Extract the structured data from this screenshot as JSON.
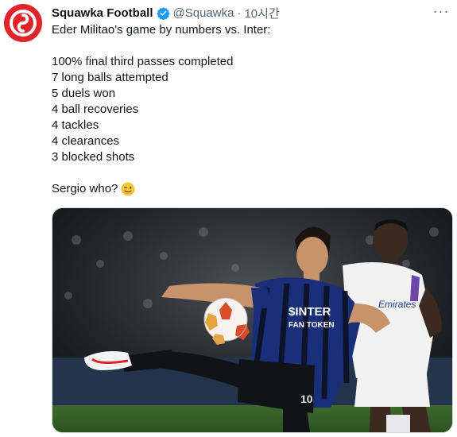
{
  "tweet": {
    "author_name": "Squawka Football",
    "handle": "@Squawka",
    "separator": "·",
    "time": "10시간",
    "more_label": "···",
    "intro": "Eder Militao's game by numbers vs. Inter:",
    "stats": [
      "100% final third passes completed",
      "7 long balls attempted",
      "5 duels won",
      "4 ball recoveries",
      "4 tackles",
      "4 clearances",
      "3 blocked shots"
    ],
    "closing": "Sergio who?"
  },
  "media": {
    "shirt_sponsor": "$INTER",
    "shirt_sponsor_sub": "FAN TOKEN",
    "kit_number": "10",
    "opponent_sponsor": "Emirates"
  },
  "colors": {
    "brand": "#e0242a",
    "verified": "#1d9bf0",
    "muted": "#536471",
    "text": "#0f1419"
  },
  "icons": {
    "avatar": "squawka-logo",
    "verified": "verified-badge-icon",
    "more": "more-horizontal-icon",
    "emoji": "winking-face-emoji"
  }
}
